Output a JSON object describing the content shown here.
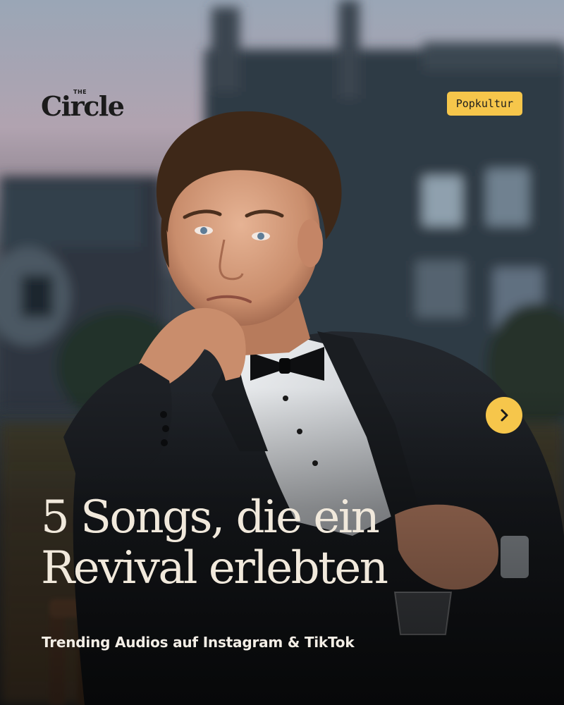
{
  "brand": {
    "logo_small": "THE",
    "logo_main": "Circle"
  },
  "tag": {
    "label": "Popkultur"
  },
  "navigation": {
    "next_icon": "chevron-right-icon"
  },
  "headline": {
    "line1": "5 Songs, die ein",
    "line2": "Revival erlebten"
  },
  "subline": "Trending Audios auf Instagram & TikTok",
  "colors": {
    "accent": "#f6c64b",
    "headline_text": "#f1e9dc",
    "logo_text": "#1b1b1b"
  }
}
